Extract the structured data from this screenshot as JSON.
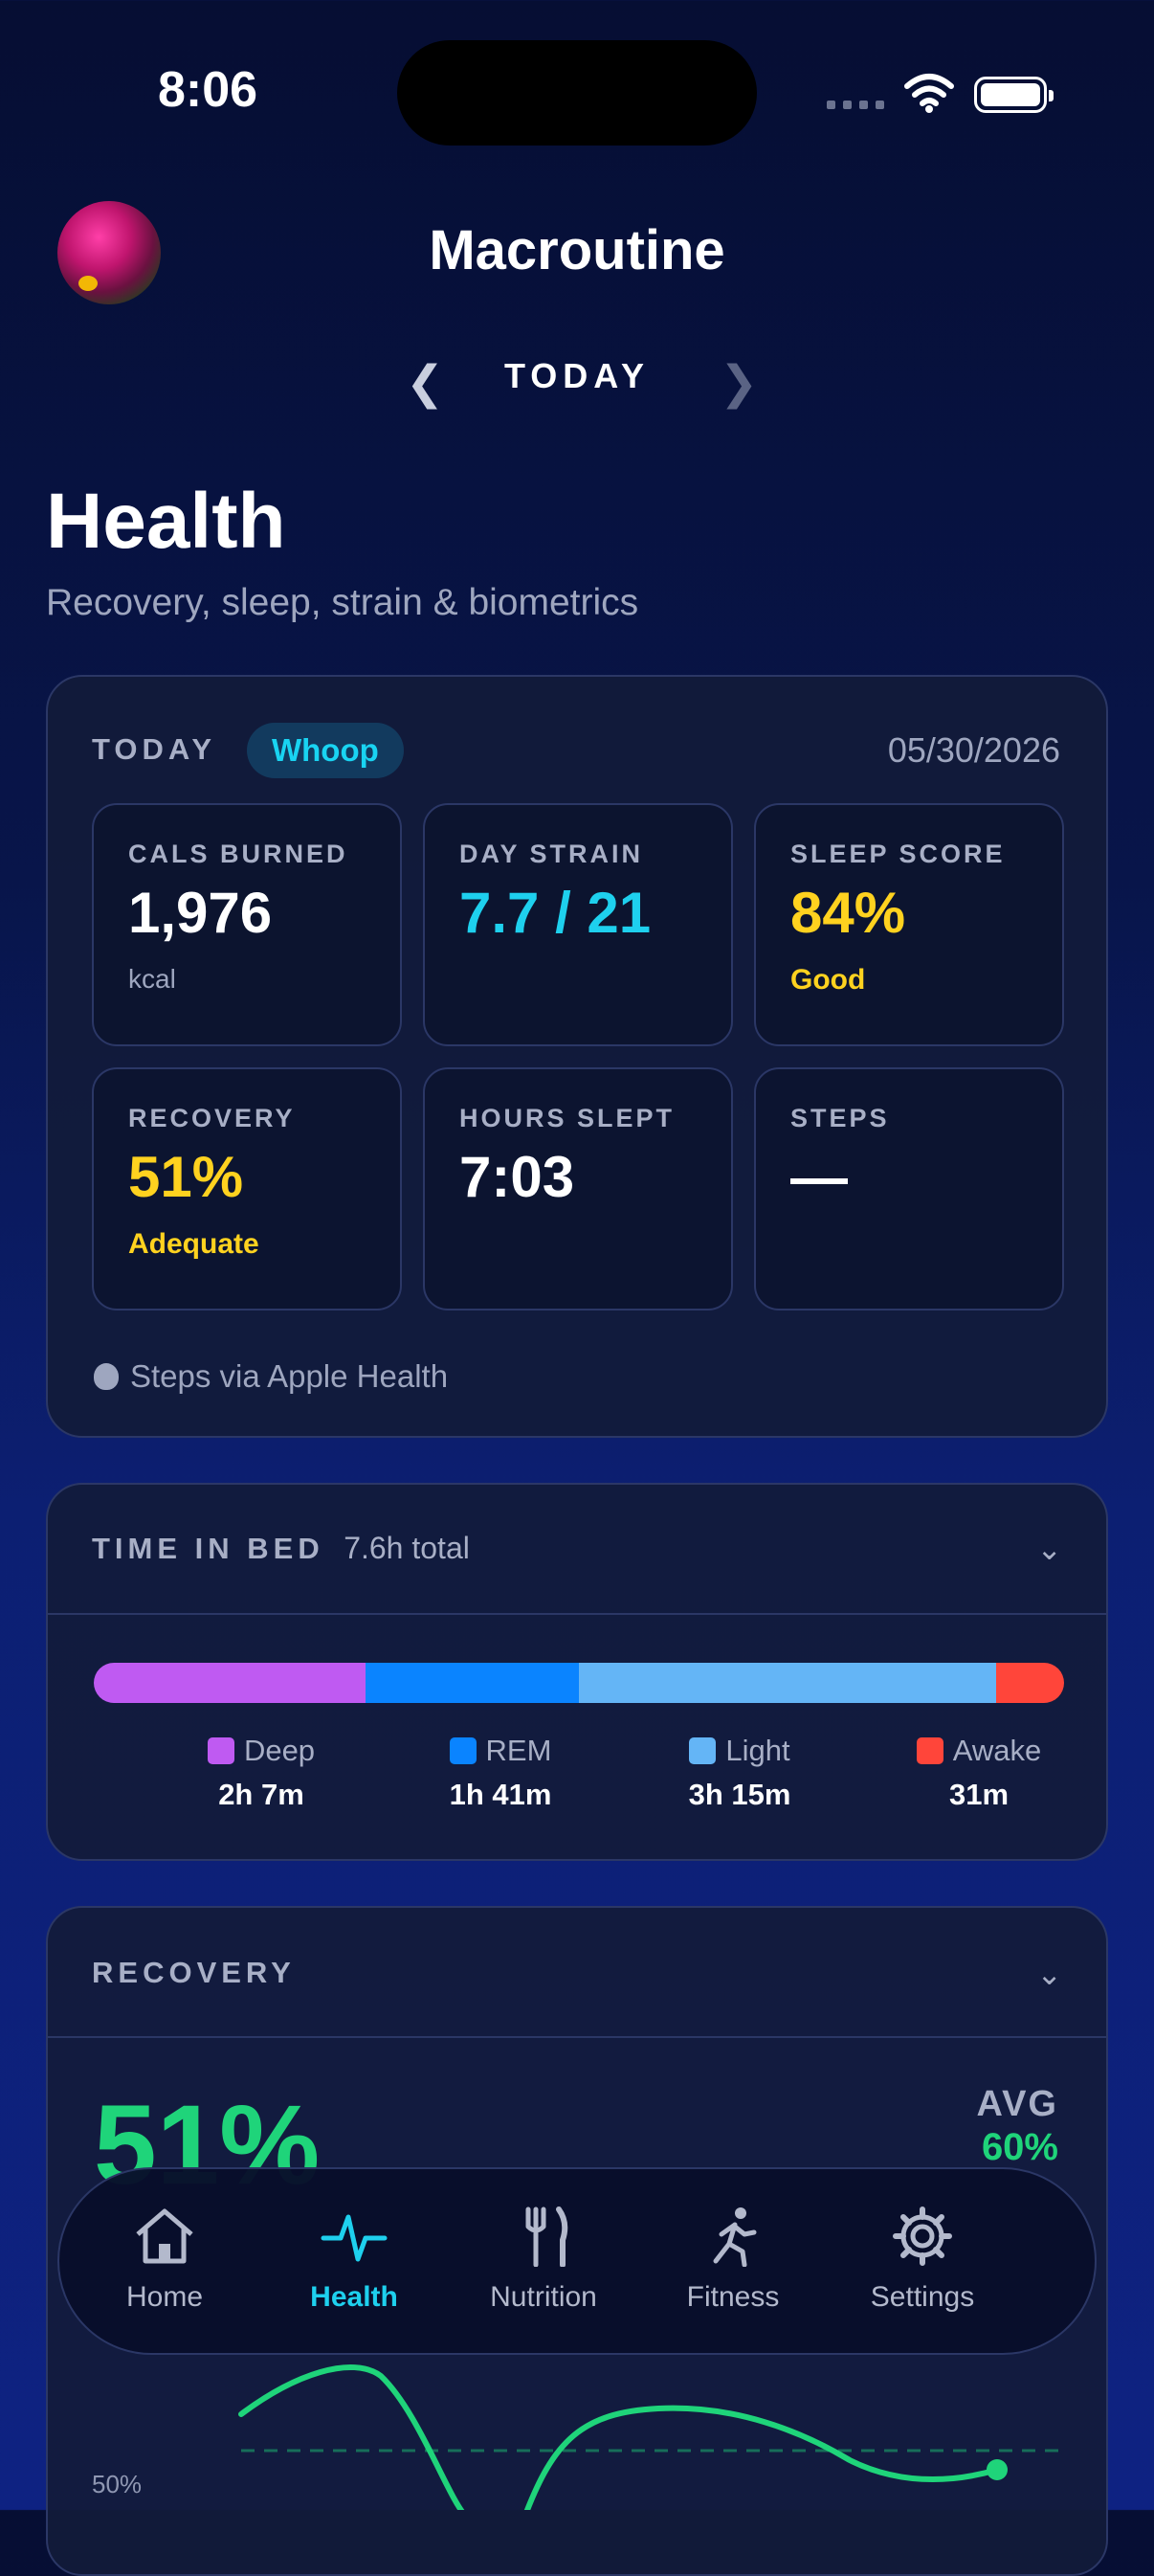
{
  "status_bar": {
    "time": "8:06"
  },
  "header": {
    "app_title": "Macroutine",
    "date_nav_label": "TODAY"
  },
  "page": {
    "title": "Health",
    "subtitle": "Recovery, sleep, strain & biometrics"
  },
  "today_card": {
    "label": "TODAY",
    "source_badge": "Whoop",
    "date": "05/30/2026",
    "tiles": [
      {
        "label": "CALS BURNED",
        "value": "1,976",
        "sub": "kcal",
        "value_color": "#ffffff",
        "sub_color": "#9ea6bf"
      },
      {
        "label": "DAY STRAIN",
        "value": "7.7 / 21",
        "sub": "",
        "value_color": "#1ed0ee",
        "sub_color": "#9ea6bf"
      },
      {
        "label": "SLEEP SCORE",
        "value": "84%",
        "sub": "Good",
        "value_color": "#ffd21f",
        "sub_color": "#ffd21f"
      },
      {
        "label": "RECOVERY",
        "value": "51%",
        "sub": "Adequate",
        "value_color": "#ffd21f",
        "sub_color": "#ffd21f"
      },
      {
        "label": "HOURS SLEPT",
        "value": "7:03",
        "sub": "",
        "value_color": "#ffffff",
        "sub_color": "#9ea6bf"
      },
      {
        "label": "STEPS",
        "value": "—",
        "sub": "",
        "value_color": "#ffffff",
        "sub_color": "#9ea6bf"
      }
    ],
    "steps_note": "Steps via Apple Health"
  },
  "time_in_bed": {
    "label": "TIME IN BED",
    "total": "7.6h total",
    "stages": [
      {
        "name": "Deep",
        "duration": "2h 7m",
        "fraction": 0.28,
        "color": "#bf5af2"
      },
      {
        "name": "REM",
        "duration": "1h 41m",
        "fraction": 0.22,
        "color": "#0a84ff"
      },
      {
        "name": "Light",
        "duration": "3h 15m",
        "fraction": 0.43,
        "color": "#64b5f6"
      },
      {
        "name": "Awake",
        "duration": "31m",
        "fraction": 0.07,
        "color": "#ff453a"
      }
    ]
  },
  "recovery_card": {
    "label": "RECOVERY",
    "value": "51%",
    "avg_label": "AVG",
    "avg_value": "60%",
    "chart_ref_label": "50%",
    "accent": "#1fd47a"
  },
  "tab_bar": {
    "tabs": [
      {
        "label": "Home",
        "icon": "home-icon"
      },
      {
        "label": "Health",
        "icon": "heartbeat-icon",
        "active": true
      },
      {
        "label": "Nutrition",
        "icon": "fork-knife-icon"
      },
      {
        "label": "Fitness",
        "icon": "running-icon"
      },
      {
        "label": "Settings",
        "icon": "gear-icon"
      }
    ]
  }
}
